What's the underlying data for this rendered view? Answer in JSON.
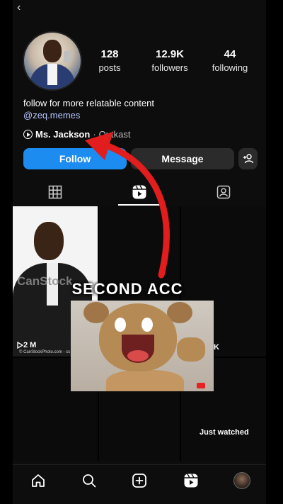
{
  "profile": {
    "stats": [
      {
        "value": "128",
        "label": "posts"
      },
      {
        "value": "12.9K",
        "label": "followers"
      },
      {
        "value": "44",
        "label": "following"
      }
    ],
    "bio": "follow for more relatable content",
    "handle": "@zeq.memes",
    "music": {
      "song": "Ms. Jackson",
      "separator": "·",
      "artist": "Outkast"
    }
  },
  "buttons": {
    "follow": "Follow",
    "message": "Message"
  },
  "tabs": [
    {
      "icon": "grid-icon",
      "active": false
    },
    {
      "icon": "reels-icon",
      "active": true
    },
    {
      "icon": "tagged-icon",
      "active": false
    }
  ],
  "grid": {
    "tile1": {
      "watermark": "CanStock",
      "credit": "© CanStockPhoto.com - cs",
      "views": "2 M"
    },
    "tile2": {
      "views": "K"
    }
  },
  "overlay": {
    "text": "SECOND ACC",
    "label": "Just watched"
  },
  "colors": {
    "accent": "#1d8cf0",
    "arrow": "#e21d1d",
    "background": "#0d0d0d"
  },
  "bottom_nav": [
    "home-icon",
    "search-icon",
    "create-icon",
    "reels-icon",
    "profile-avatar"
  ]
}
